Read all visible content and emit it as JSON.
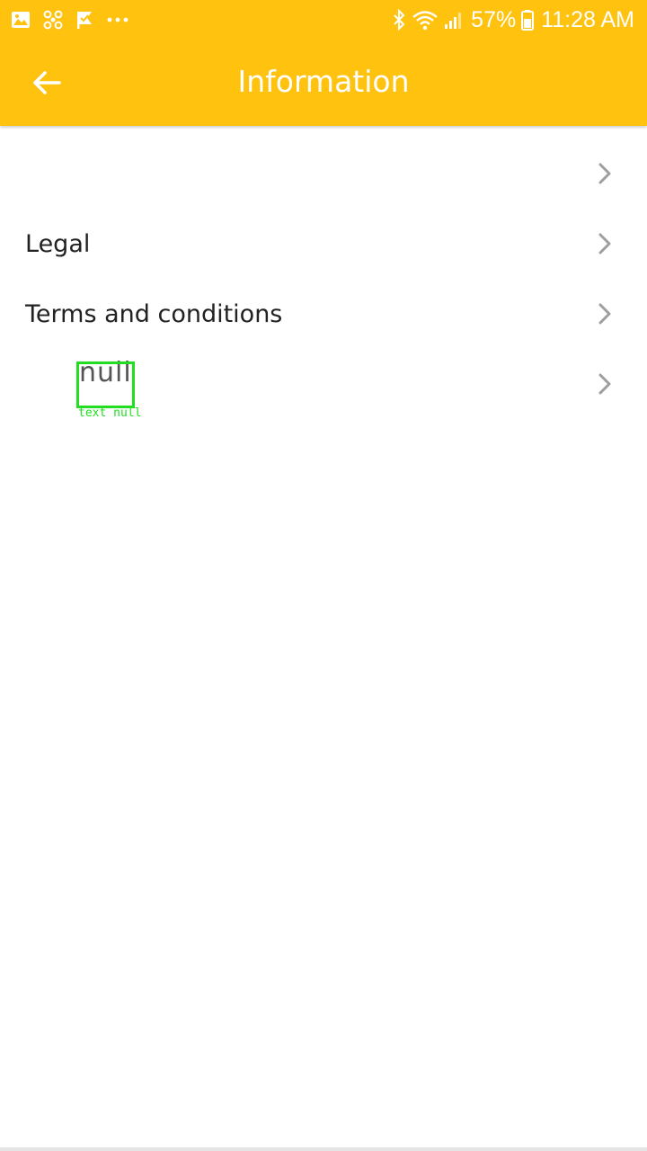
{
  "colors": {
    "accent": "#FFC20E",
    "on_accent": "#FFFFFF",
    "text_primary": "#222222",
    "chevron": "#9E9E9E",
    "debug_overlay": "#22DD22"
  },
  "status_bar": {
    "left_icons": [
      "gallery-icon",
      "fan-icon",
      "check-flag-icon",
      "more-dots-icon"
    ],
    "right_icons": [
      "bluetooth-icon",
      "wifi-icon",
      "cell-signal-icon",
      "battery-icon"
    ],
    "battery": "57%",
    "time": "11:28 AM"
  },
  "app_bar": {
    "title": "Information",
    "back_icon": "arrow-left-icon"
  },
  "menu": {
    "items": [
      {
        "label": ""
      },
      {
        "label": "Legal"
      },
      {
        "label": "Terms and conditions"
      },
      {
        "label": ""
      }
    ],
    "chevron_icon": "chevron-right-icon"
  },
  "debug_overlay": {
    "text": "null",
    "caption": "text null"
  }
}
